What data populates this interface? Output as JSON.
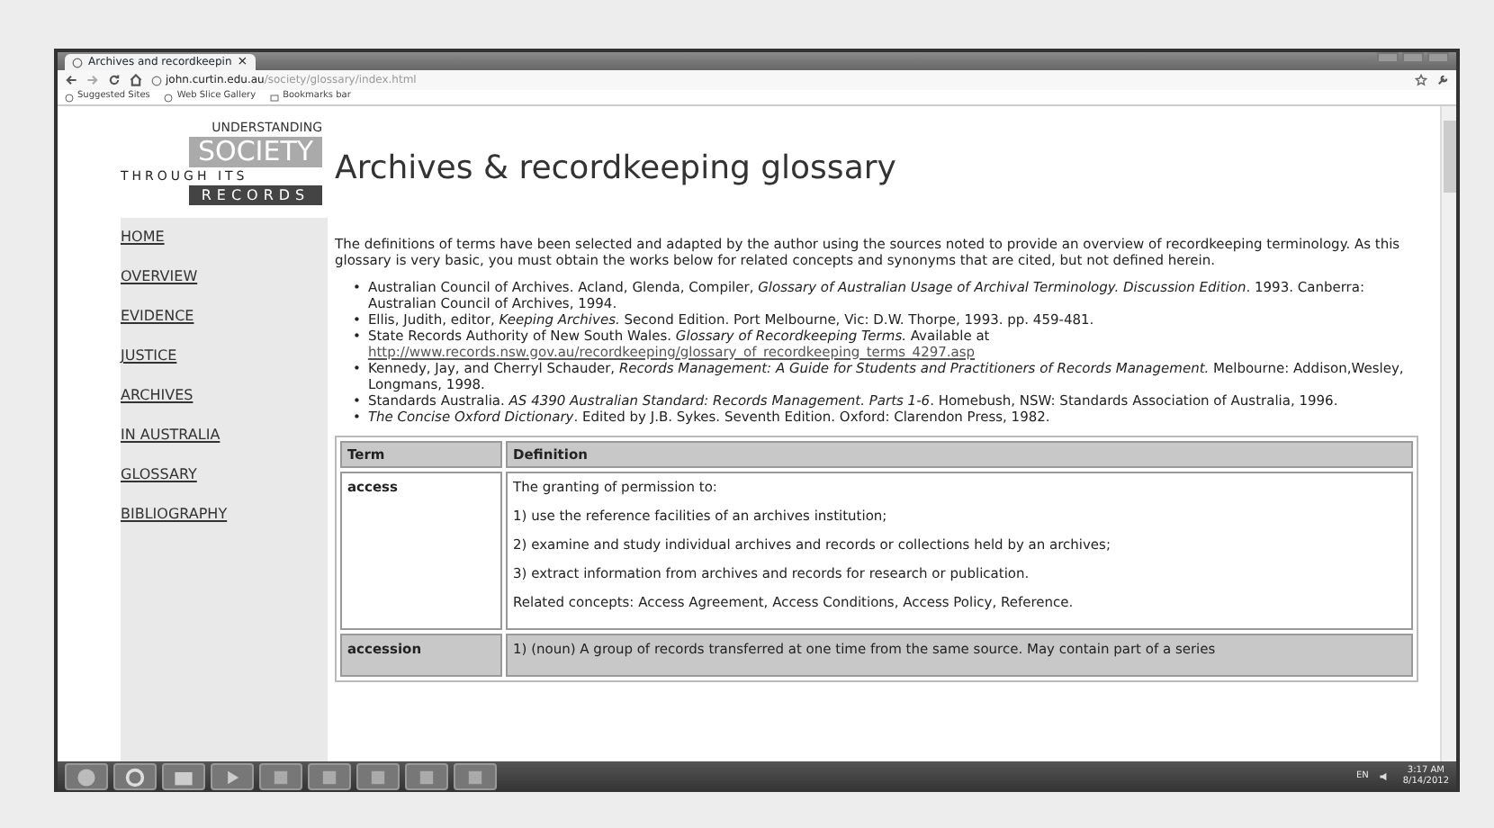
{
  "browser": {
    "tab_title": "Archives and recordkeepin",
    "tab_close": "×",
    "address_host": "john.curtin.edu.au",
    "address_path": "/society/glossary/index.html",
    "bookmarks": [
      "Suggested Sites",
      "Web Slice Gallery",
      "Bookmarks bar"
    ]
  },
  "logo": {
    "line_1": "UNDERSTANDING",
    "line_2": "SOCIETY",
    "line_3": "THROUGH ITS",
    "line_4": "RECORDS"
  },
  "sidebar": {
    "items": [
      "HOME",
      "OVERVIEW",
      "EVIDENCE",
      "JUSTICE",
      "ARCHIVES",
      "IN AUSTRALIA",
      "GLOSSARY",
      "BIBLIOGRAPHY"
    ]
  },
  "page": {
    "title": "Archives & recordkeeping glossary",
    "intro": "The definitions of terms have been selected and adapted by the author using the sources noted to provide an overview of recordkeeping terminology. As this glossary is very basic, you must obtain the works below for related concepts and synonyms that are cited, but not defined herein.",
    "sources": [
      {
        "bullet": "•",
        "text": "Australian Council of Archives. Acland, Glenda, Compiler, *Glossary of Australian Usage of Archival Terminology. Discussion Edition*. 1993. Canberra: Australian Council of Archives, 1994."
      },
      {
        "bullet": "•",
        "text": "Ellis, Judith, editor, *Keeping Archives.* Second Edition. Port Melbourne, Vic: D.W. Thorpe, 1993. pp. 459-481."
      },
      {
        "bullet": "•",
        "text": "State Records Authority of New South Wales. *Glossary of Recordkeeping Terms.* Available at",
        "link": "http://www.records.nsw.gov.au/recordkeeping/glossary_of_recordkeeping_terms_4297.asp"
      },
      {
        "bullet": "•",
        "text": "Kennedy, Jay, and Cherryl Schauder, *Records Management: A Guide for Students and Practitioners of Records Management.* Melbourne: Addison,Wesley, Longmans, 1998."
      },
      {
        "bullet": "•",
        "text": "Standards Australia. *AS 4390 Australian Standard: Records Management. Parts 1-6*. Homebush, NSW: Standards Association of Australia, 1996."
      },
      {
        "bullet": "•",
        "text": "*The Concise Oxford Dictionary*. Edited by J.B. Sykes. Seventh Edition. Oxford: Clarendon Press, 1982."
      }
    ],
    "table": {
      "columns": [
        "Term",
        "Definition"
      ],
      "rows": [
        {
          "term": "access",
          "shaded": false,
          "definition": [
            "The granting of permission to:",
            "1) use the reference facilities of an archives institution;",
            "2) examine and study individual archives and records or collections held by an archives;",
            "3) extract information from archives and records for research or publication.",
            "Related concepts: Access Agreement, Access Conditions, Access Policy, Reference."
          ]
        },
        {
          "term": "accession",
          "shaded": true,
          "definition": [
            "1) (noun) A group of records transferred at one time from the same source. May contain part of a series"
          ]
        }
      ]
    }
  },
  "taskbar": {
    "tray_lang": "EN",
    "time": "3:17 AM",
    "date": "8/14/2012"
  }
}
